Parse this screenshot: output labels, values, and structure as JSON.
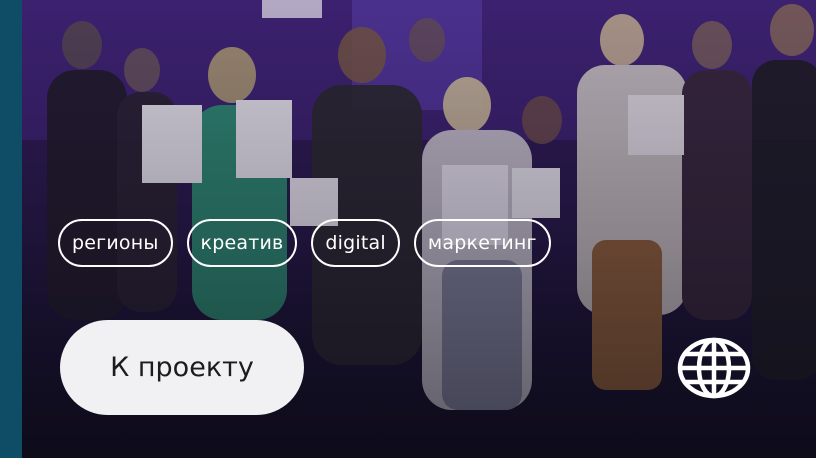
{
  "tags": [
    {
      "label": "регионы"
    },
    {
      "label": "креатив"
    },
    {
      "label": "digital"
    },
    {
      "label": "маркетинг"
    }
  ],
  "cta": {
    "label": "К проекту"
  },
  "icons": {
    "globe": "globe-icon"
  },
  "colors": {
    "background_strip": "#0f4c66",
    "button_bg": "#f1f0f3",
    "text_light": "#ffffff",
    "text_dark": "#1c1c1e"
  }
}
